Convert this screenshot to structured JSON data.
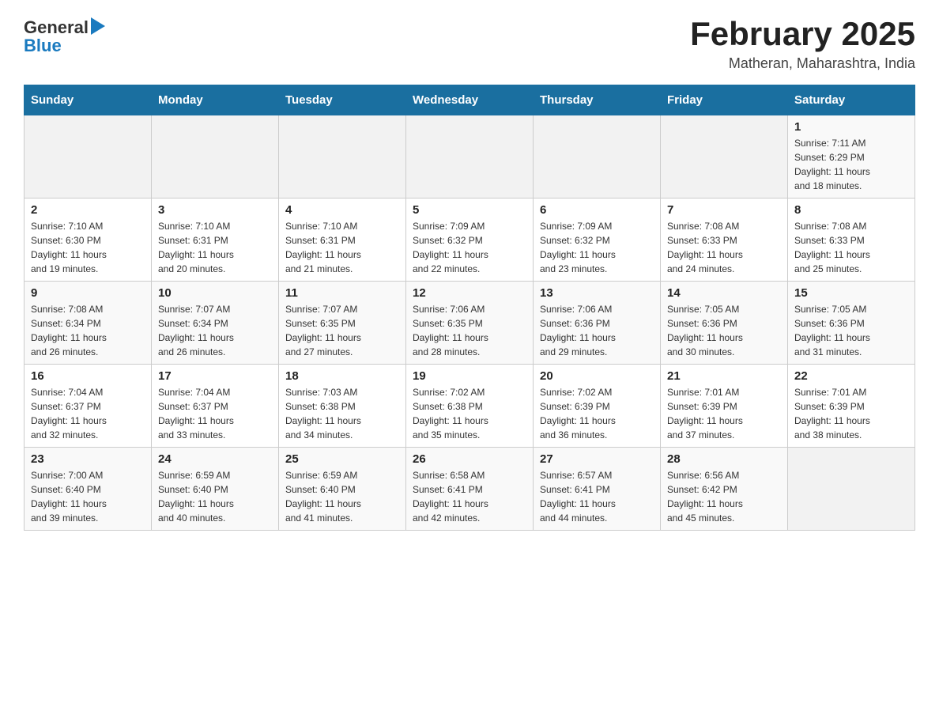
{
  "logo": {
    "text_general": "General",
    "text_blue": "Blue",
    "triangle_char": "▶"
  },
  "header": {
    "month_title": "February 2025",
    "location": "Matheran, Maharashtra, India"
  },
  "weekdays": [
    "Sunday",
    "Monday",
    "Tuesday",
    "Wednesday",
    "Thursday",
    "Friday",
    "Saturday"
  ],
  "weeks": [
    [
      {
        "day": "",
        "info": ""
      },
      {
        "day": "",
        "info": ""
      },
      {
        "day": "",
        "info": ""
      },
      {
        "day": "",
        "info": ""
      },
      {
        "day": "",
        "info": ""
      },
      {
        "day": "",
        "info": ""
      },
      {
        "day": "1",
        "info": "Sunrise: 7:11 AM\nSunset: 6:29 PM\nDaylight: 11 hours\nand 18 minutes."
      }
    ],
    [
      {
        "day": "2",
        "info": "Sunrise: 7:10 AM\nSunset: 6:30 PM\nDaylight: 11 hours\nand 19 minutes."
      },
      {
        "day": "3",
        "info": "Sunrise: 7:10 AM\nSunset: 6:31 PM\nDaylight: 11 hours\nand 20 minutes."
      },
      {
        "day": "4",
        "info": "Sunrise: 7:10 AM\nSunset: 6:31 PM\nDaylight: 11 hours\nand 21 minutes."
      },
      {
        "day": "5",
        "info": "Sunrise: 7:09 AM\nSunset: 6:32 PM\nDaylight: 11 hours\nand 22 minutes."
      },
      {
        "day": "6",
        "info": "Sunrise: 7:09 AM\nSunset: 6:32 PM\nDaylight: 11 hours\nand 23 minutes."
      },
      {
        "day": "7",
        "info": "Sunrise: 7:08 AM\nSunset: 6:33 PM\nDaylight: 11 hours\nand 24 minutes."
      },
      {
        "day": "8",
        "info": "Sunrise: 7:08 AM\nSunset: 6:33 PM\nDaylight: 11 hours\nand 25 minutes."
      }
    ],
    [
      {
        "day": "9",
        "info": "Sunrise: 7:08 AM\nSunset: 6:34 PM\nDaylight: 11 hours\nand 26 minutes."
      },
      {
        "day": "10",
        "info": "Sunrise: 7:07 AM\nSunset: 6:34 PM\nDaylight: 11 hours\nand 26 minutes."
      },
      {
        "day": "11",
        "info": "Sunrise: 7:07 AM\nSunset: 6:35 PM\nDaylight: 11 hours\nand 27 minutes."
      },
      {
        "day": "12",
        "info": "Sunrise: 7:06 AM\nSunset: 6:35 PM\nDaylight: 11 hours\nand 28 minutes."
      },
      {
        "day": "13",
        "info": "Sunrise: 7:06 AM\nSunset: 6:36 PM\nDaylight: 11 hours\nand 29 minutes."
      },
      {
        "day": "14",
        "info": "Sunrise: 7:05 AM\nSunset: 6:36 PM\nDaylight: 11 hours\nand 30 minutes."
      },
      {
        "day": "15",
        "info": "Sunrise: 7:05 AM\nSunset: 6:36 PM\nDaylight: 11 hours\nand 31 minutes."
      }
    ],
    [
      {
        "day": "16",
        "info": "Sunrise: 7:04 AM\nSunset: 6:37 PM\nDaylight: 11 hours\nand 32 minutes."
      },
      {
        "day": "17",
        "info": "Sunrise: 7:04 AM\nSunset: 6:37 PM\nDaylight: 11 hours\nand 33 minutes."
      },
      {
        "day": "18",
        "info": "Sunrise: 7:03 AM\nSunset: 6:38 PM\nDaylight: 11 hours\nand 34 minutes."
      },
      {
        "day": "19",
        "info": "Sunrise: 7:02 AM\nSunset: 6:38 PM\nDaylight: 11 hours\nand 35 minutes."
      },
      {
        "day": "20",
        "info": "Sunrise: 7:02 AM\nSunset: 6:39 PM\nDaylight: 11 hours\nand 36 minutes."
      },
      {
        "day": "21",
        "info": "Sunrise: 7:01 AM\nSunset: 6:39 PM\nDaylight: 11 hours\nand 37 minutes."
      },
      {
        "day": "22",
        "info": "Sunrise: 7:01 AM\nSunset: 6:39 PM\nDaylight: 11 hours\nand 38 minutes."
      }
    ],
    [
      {
        "day": "23",
        "info": "Sunrise: 7:00 AM\nSunset: 6:40 PM\nDaylight: 11 hours\nand 39 minutes."
      },
      {
        "day": "24",
        "info": "Sunrise: 6:59 AM\nSunset: 6:40 PM\nDaylight: 11 hours\nand 40 minutes."
      },
      {
        "day": "25",
        "info": "Sunrise: 6:59 AM\nSunset: 6:40 PM\nDaylight: 11 hours\nand 41 minutes."
      },
      {
        "day": "26",
        "info": "Sunrise: 6:58 AM\nSunset: 6:41 PM\nDaylight: 11 hours\nand 42 minutes."
      },
      {
        "day": "27",
        "info": "Sunrise: 6:57 AM\nSunset: 6:41 PM\nDaylight: 11 hours\nand 44 minutes."
      },
      {
        "day": "28",
        "info": "Sunrise: 6:56 AM\nSunset: 6:42 PM\nDaylight: 11 hours\nand 45 minutes."
      },
      {
        "day": "",
        "info": ""
      }
    ]
  ]
}
